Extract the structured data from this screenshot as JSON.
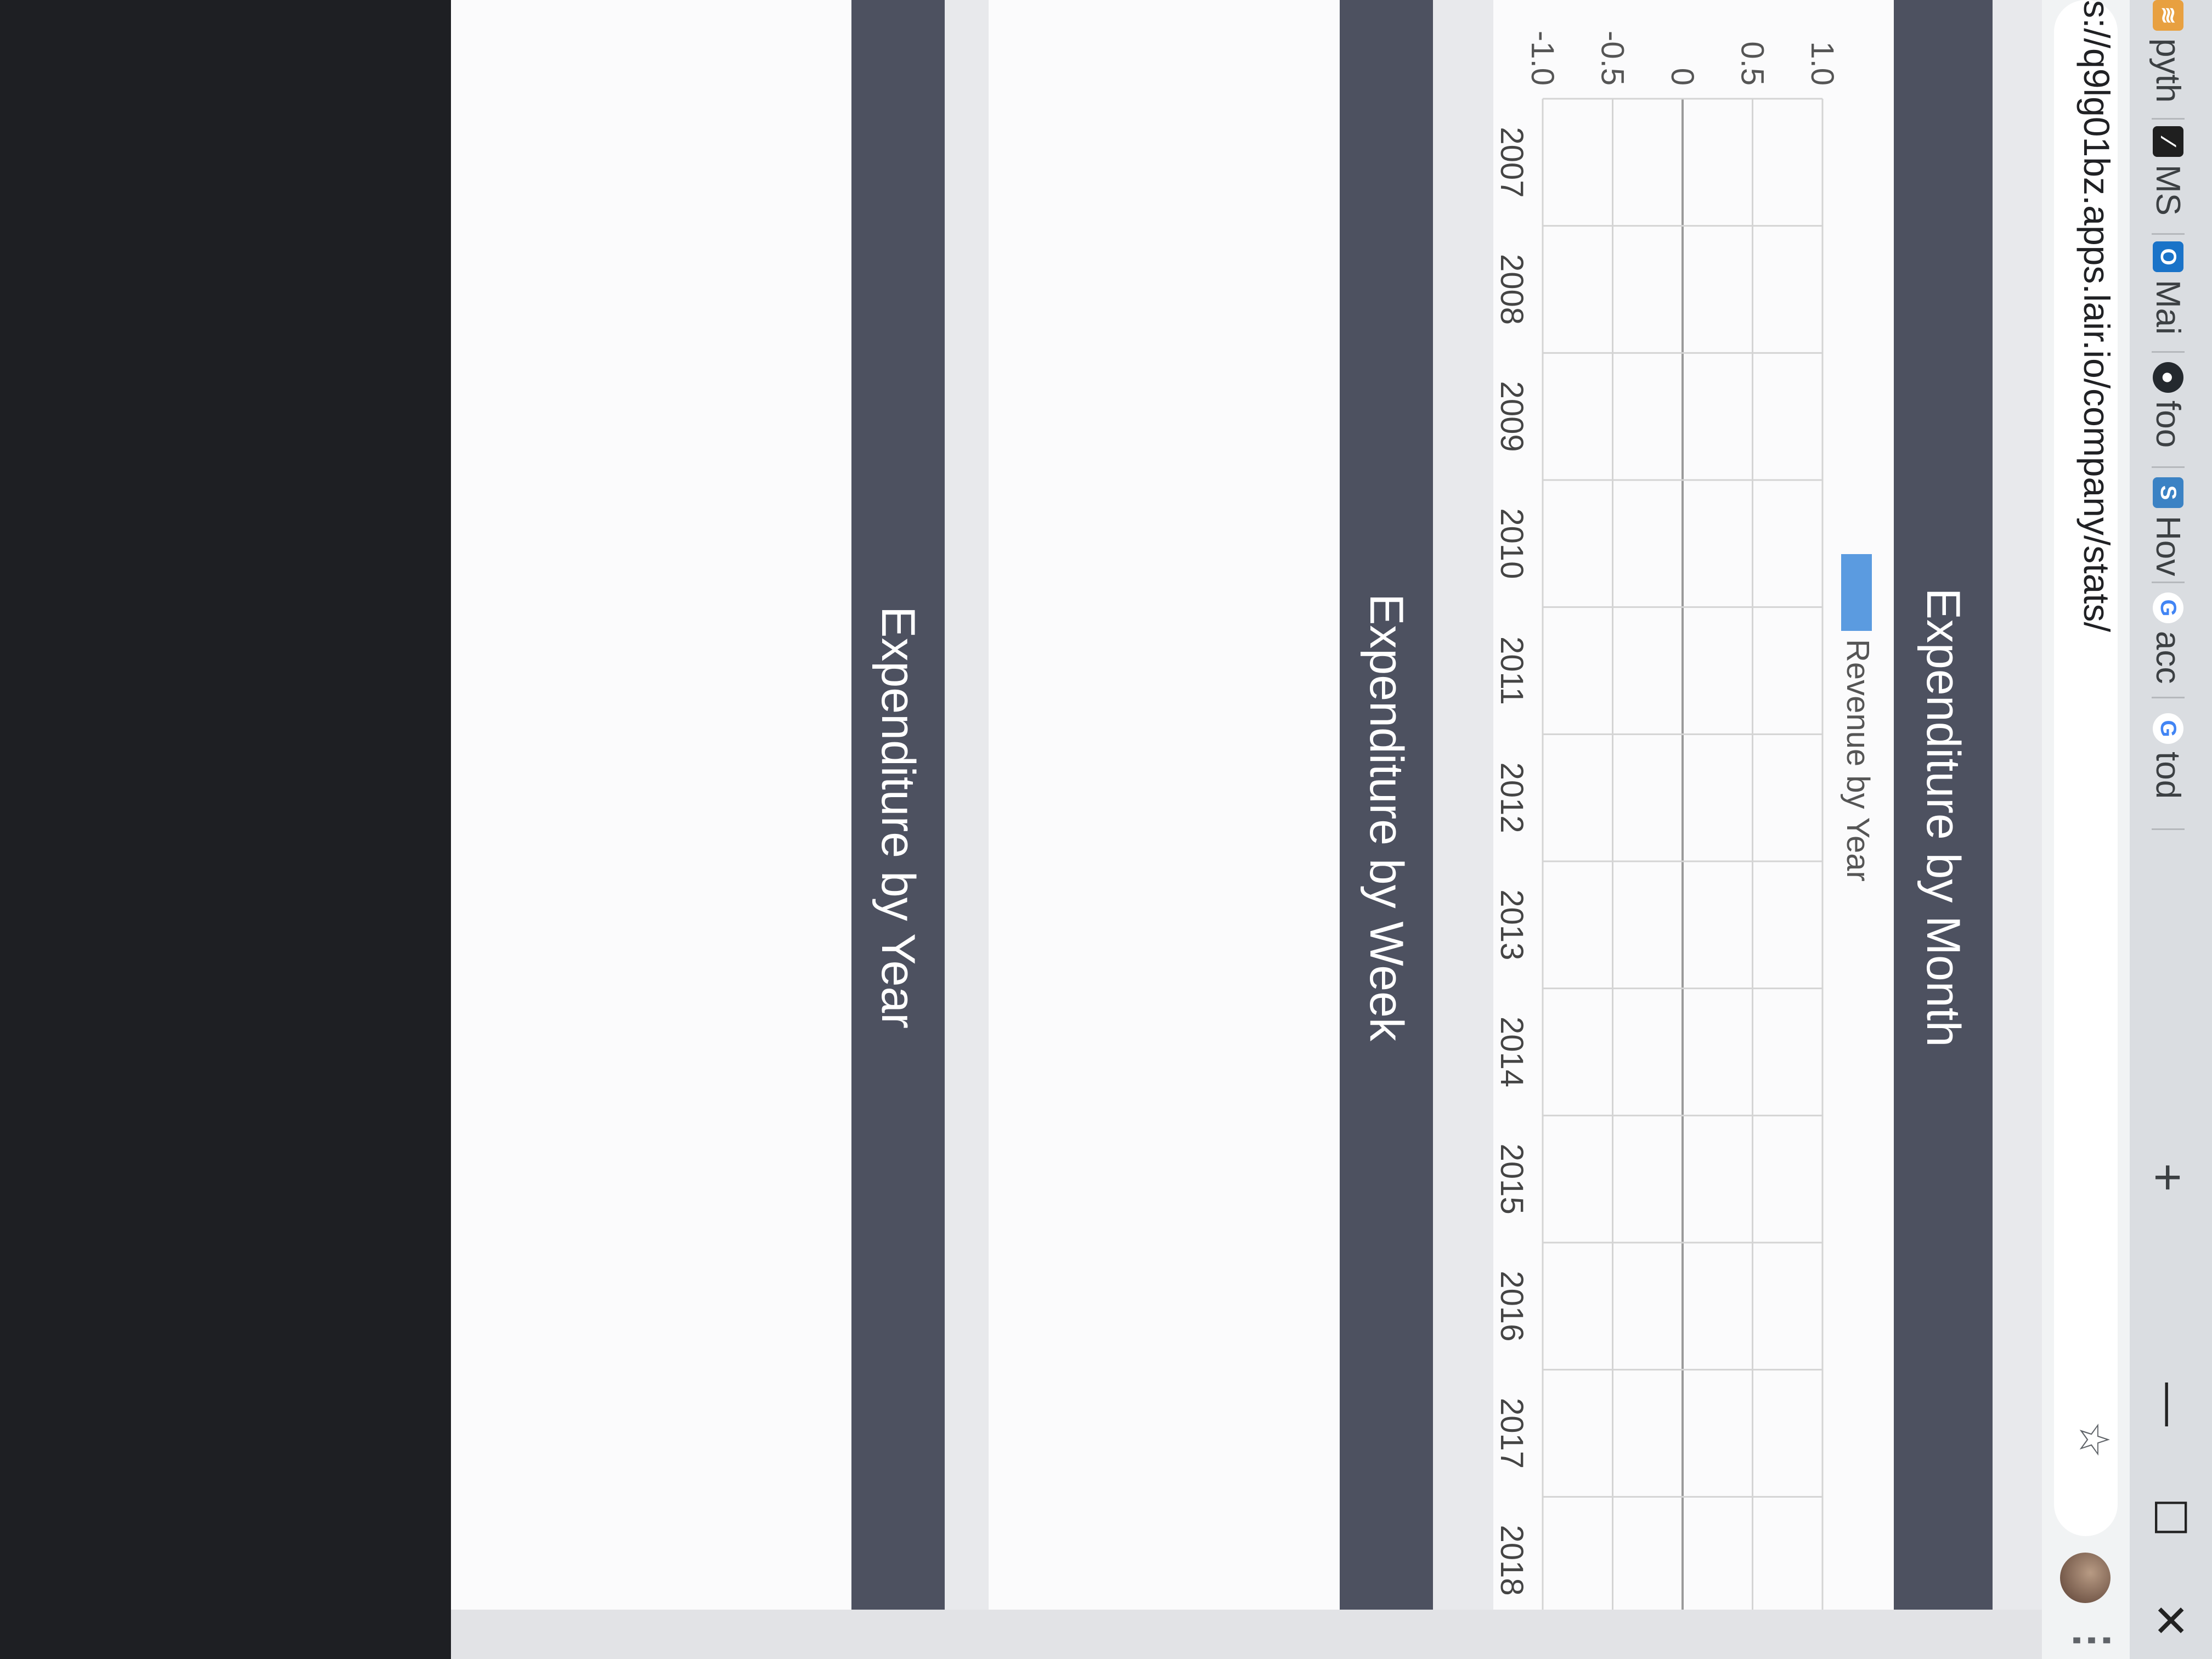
{
  "browser": {
    "tabs": [
      {
        "label": "pyth",
        "icon": "python-icon"
      },
      {
        "label": "MS",
        "icon": "ms-doc-icon"
      },
      {
        "label": "Mai",
        "icon": "outlook-icon"
      },
      {
        "label": "foo",
        "icon": "github-icon"
      },
      {
        "label": "Hov",
        "icon": "stackexchange-icon"
      },
      {
        "label": "acc",
        "icon": "google-icon"
      },
      {
        "label": "tod",
        "icon": "google-icon"
      }
    ],
    "new_tab_label": "+",
    "address": "s://q9lg01bz.apps.lair.io/company/stats/",
    "window_controls": {
      "minimize": "—",
      "maximize": "☐",
      "close": "✕"
    },
    "menu_label": "⋮"
  },
  "panels": {
    "month": {
      "title": "Expenditure by Month"
    },
    "week": {
      "title": "Expenditure by Week"
    },
    "year": {
      "title": "Expenditure by Year"
    }
  },
  "chart_data": {
    "type": "bar",
    "categories": [
      "2007",
      "2008",
      "2009",
      "2010",
      "2011",
      "2012",
      "2013",
      "2014",
      "2015",
      "2016",
      "2017",
      "2018"
    ],
    "series": [
      {
        "name": "Revenue by Year",
        "values": [
          0,
          0,
          0,
          0,
          0,
          0,
          0,
          0,
          0,
          0,
          0,
          0
        ],
        "color": "#5b9be0"
      }
    ],
    "ylim": [
      -1.0,
      1.0
    ],
    "yticks": [
      "-1.0",
      "-0.5",
      "0",
      "0.5",
      "1.0"
    ],
    "grid": true,
    "legend": "top"
  }
}
